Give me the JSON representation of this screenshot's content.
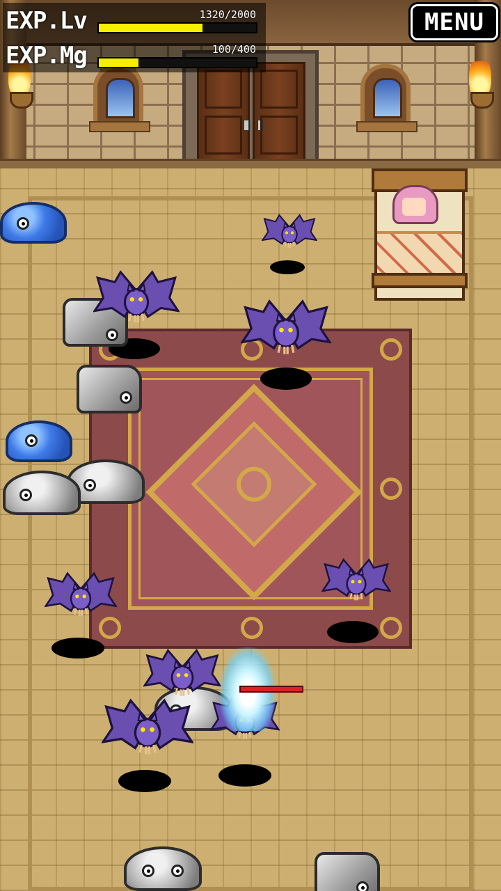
{
  "hud": {
    "exp_level": {
      "label": "EXP.Lv",
      "value_text": "1320/2000",
      "current": 1320,
      "max": 2000
    },
    "exp_magic": {
      "label": "EXP.Mg",
      "value_text": "100/400",
      "current": 100,
      "max": 400
    }
  },
  "menu": {
    "label": "MENU"
  },
  "colors": {
    "exp_bar": "#f7ef00",
    "hp_bar": "#e02020"
  },
  "scene": {
    "enemies": {
      "blue_slimes": 2,
      "gray_slimes": 4,
      "rock_creatures": 3,
      "bats": 7
    }
  }
}
